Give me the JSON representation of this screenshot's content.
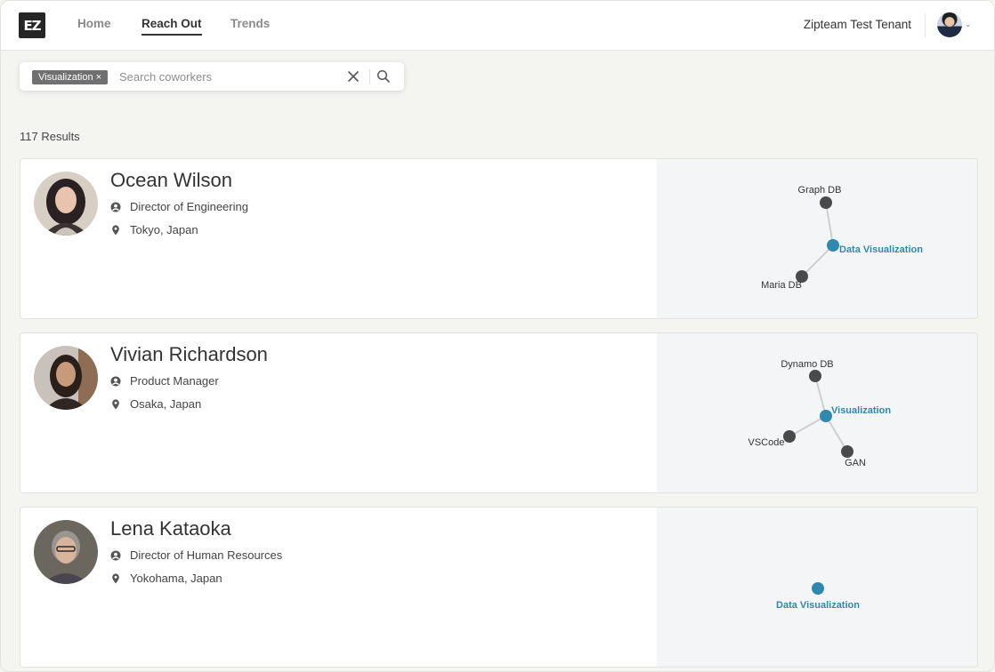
{
  "header": {
    "logo_text": "EZ",
    "nav": [
      {
        "label": "Home",
        "active": false
      },
      {
        "label": "Reach Out",
        "active": true
      },
      {
        "label": "Trends",
        "active": false
      }
    ],
    "tenant": "Zipteam Test Tenant"
  },
  "search": {
    "chip_label": "Visualization",
    "placeholder": "Search coworkers",
    "value": ""
  },
  "results": {
    "count_label": "117 Results"
  },
  "people": [
    {
      "name": "Ocean Wilson",
      "title": "Director of Engineering",
      "location": "Tokyo, Japan",
      "graph": {
        "center": "Data Visualization",
        "nodes": [
          "Graph DB",
          "Maria DB"
        ]
      }
    },
    {
      "name": "Vivian Richardson",
      "title": "Product Manager",
      "location": "Osaka, Japan",
      "graph": {
        "center": "Visualization",
        "nodes": [
          "Dynamo DB",
          "VSCode",
          "GAN"
        ]
      }
    },
    {
      "name": "Lena Kataoka",
      "title": "Director of Human Resources",
      "location": "Yokohama, Japan",
      "graph": {
        "center": "Data Visualization",
        "nodes": []
      }
    }
  ],
  "colors": {
    "accent": "#2f88ad",
    "node": "#4a4a4a",
    "edge": "#cfcfcf",
    "chip": "#707070",
    "graph_bg": "#f4f5f6"
  }
}
